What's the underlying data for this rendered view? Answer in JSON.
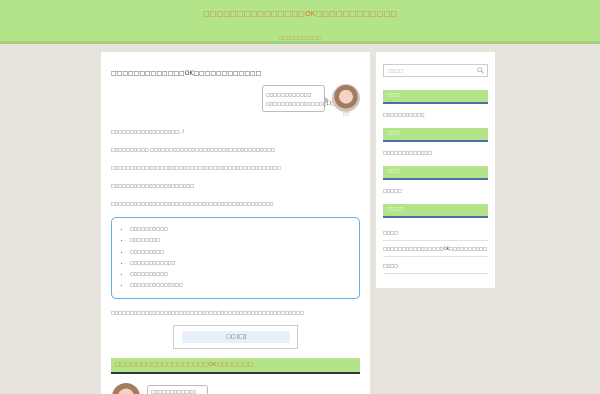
{
  "header": {
    "title": "□□□□□□□□□□□□□□□OK□□□□□□□□□□□□",
    "description": "□□□□□□□□□□□"
  },
  "article": {
    "title": "□□□□□□□□□□□□□OK□□□□□□□□□□□□",
    "speech": {
      "line1": "□□□□□□□□□□□□",
      "line2": "□□□□□□□□□□□□□□□□17□"
    },
    "author": "□□",
    "paragraphs": [
      "□□□□□□□□□□□□□□□□□□…!",
      "□□□□□□□□□□ □□□□□□□□□□□□□□□□□□□□□□□□□□□□□□□□□",
      "□□□□□□□□□□□□□□□□□□□□□□□□□□□□□□□□□□□□□□□□□□□□□",
      "□□□□□□□□□□□□□□□□□□□□□□",
      "□□□□□□□□□□□□□□□□□□□□□□□□□□□□□□□□□□□□□□□□□□□"
    ],
    "toc": [
      "□□□□□□□□□□",
      "□□□□□□□□",
      "□□□□□□□□□",
      "□□□□□□□□□□□□",
      "□□□□□□□□□□",
      "□□□□□□□□□□□□□□"
    ],
    "note": "□□□□□□□□□□□□□□□□□□□□□□□□□□□□□□□□□□□□□□□□□□□□□□□□□□□",
    "button_label": "□□ [□]",
    "section_heading": "□□□□□□□□□□□□□□□□□□OK□□□□□□□",
    "speech2": "□□□□□□□□□□□□"
  },
  "sidebar": {
    "search_placeholder": "□□□□",
    "sections": [
      {
        "heading": "□□□",
        "items": [
          "□□□□□□□□□□□"
        ]
      },
      {
        "heading": "□□□",
        "items": [
          "□□□□□□□□□□□□□"
        ]
      },
      {
        "heading": "□□□",
        "items": [
          "□□□□□"
        ]
      },
      {
        "heading": "□□□□",
        "items": [
          "□□□□",
          "□□□□□□□□□□□□□□□□OK□□□□□□□□□□",
          "□□□□"
        ]
      }
    ]
  },
  "colors": {
    "header_bg": "#b3e48a",
    "title_text": "#d87a2a",
    "toc_border": "#5fb4e6",
    "side_head_border": "#4a70a6"
  }
}
